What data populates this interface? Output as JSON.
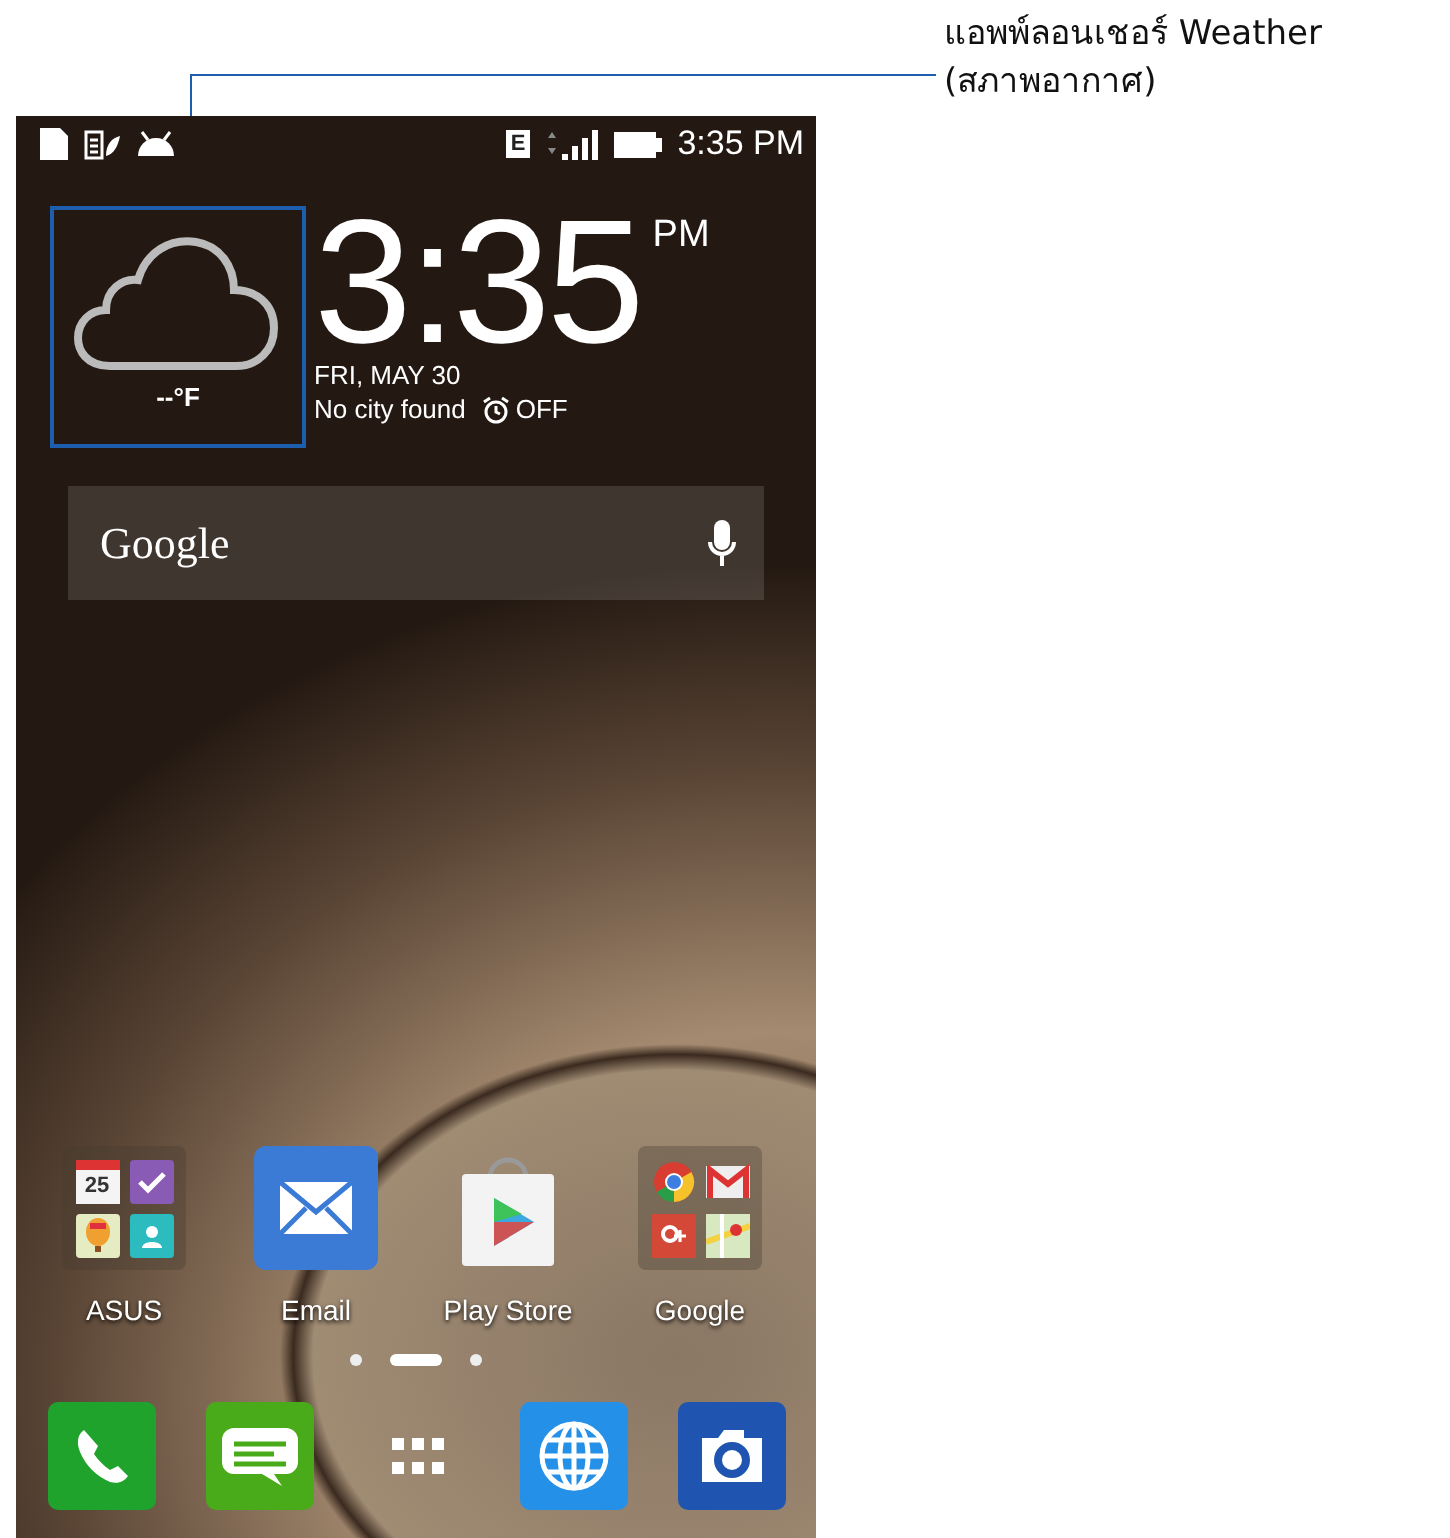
{
  "callout": {
    "lines": [
      "แอพพ์ลอนเชอร์ Weather",
      "(สภาพอากาศ)"
    ]
  },
  "status_bar": {
    "network_type": "E",
    "time": "3:35 PM"
  },
  "weather": {
    "temperature": "--°F"
  },
  "clock": {
    "time": "3:35",
    "ampm": "PM",
    "date": "FRI, MAY 30",
    "city": "No city found",
    "alarm": "OFF"
  },
  "search": {
    "label": "Google"
  },
  "apps": [
    {
      "label": "ASUS",
      "kind": "folder",
      "items": [
        {
          "kind": "calendar",
          "text": "25"
        },
        {
          "kind": "tasks"
        },
        {
          "kind": "balloon"
        },
        {
          "kind": "contacts"
        }
      ]
    },
    {
      "label": "Email",
      "kind": "email"
    },
    {
      "label": "Play Store",
      "kind": "store"
    },
    {
      "label": "Google",
      "kind": "folder",
      "items": [
        {
          "kind": "chrome"
        },
        {
          "kind": "gmail"
        },
        {
          "kind": "gplus"
        },
        {
          "kind": "maps"
        }
      ]
    }
  ],
  "pages": [
    {
      "selected": false
    },
    {
      "selected": true
    },
    {
      "selected": false
    }
  ],
  "dock": [
    {
      "kind": "phone"
    },
    {
      "kind": "messages"
    },
    {
      "kind": "apps"
    },
    {
      "kind": "browser"
    },
    {
      "kind": "camera"
    }
  ]
}
